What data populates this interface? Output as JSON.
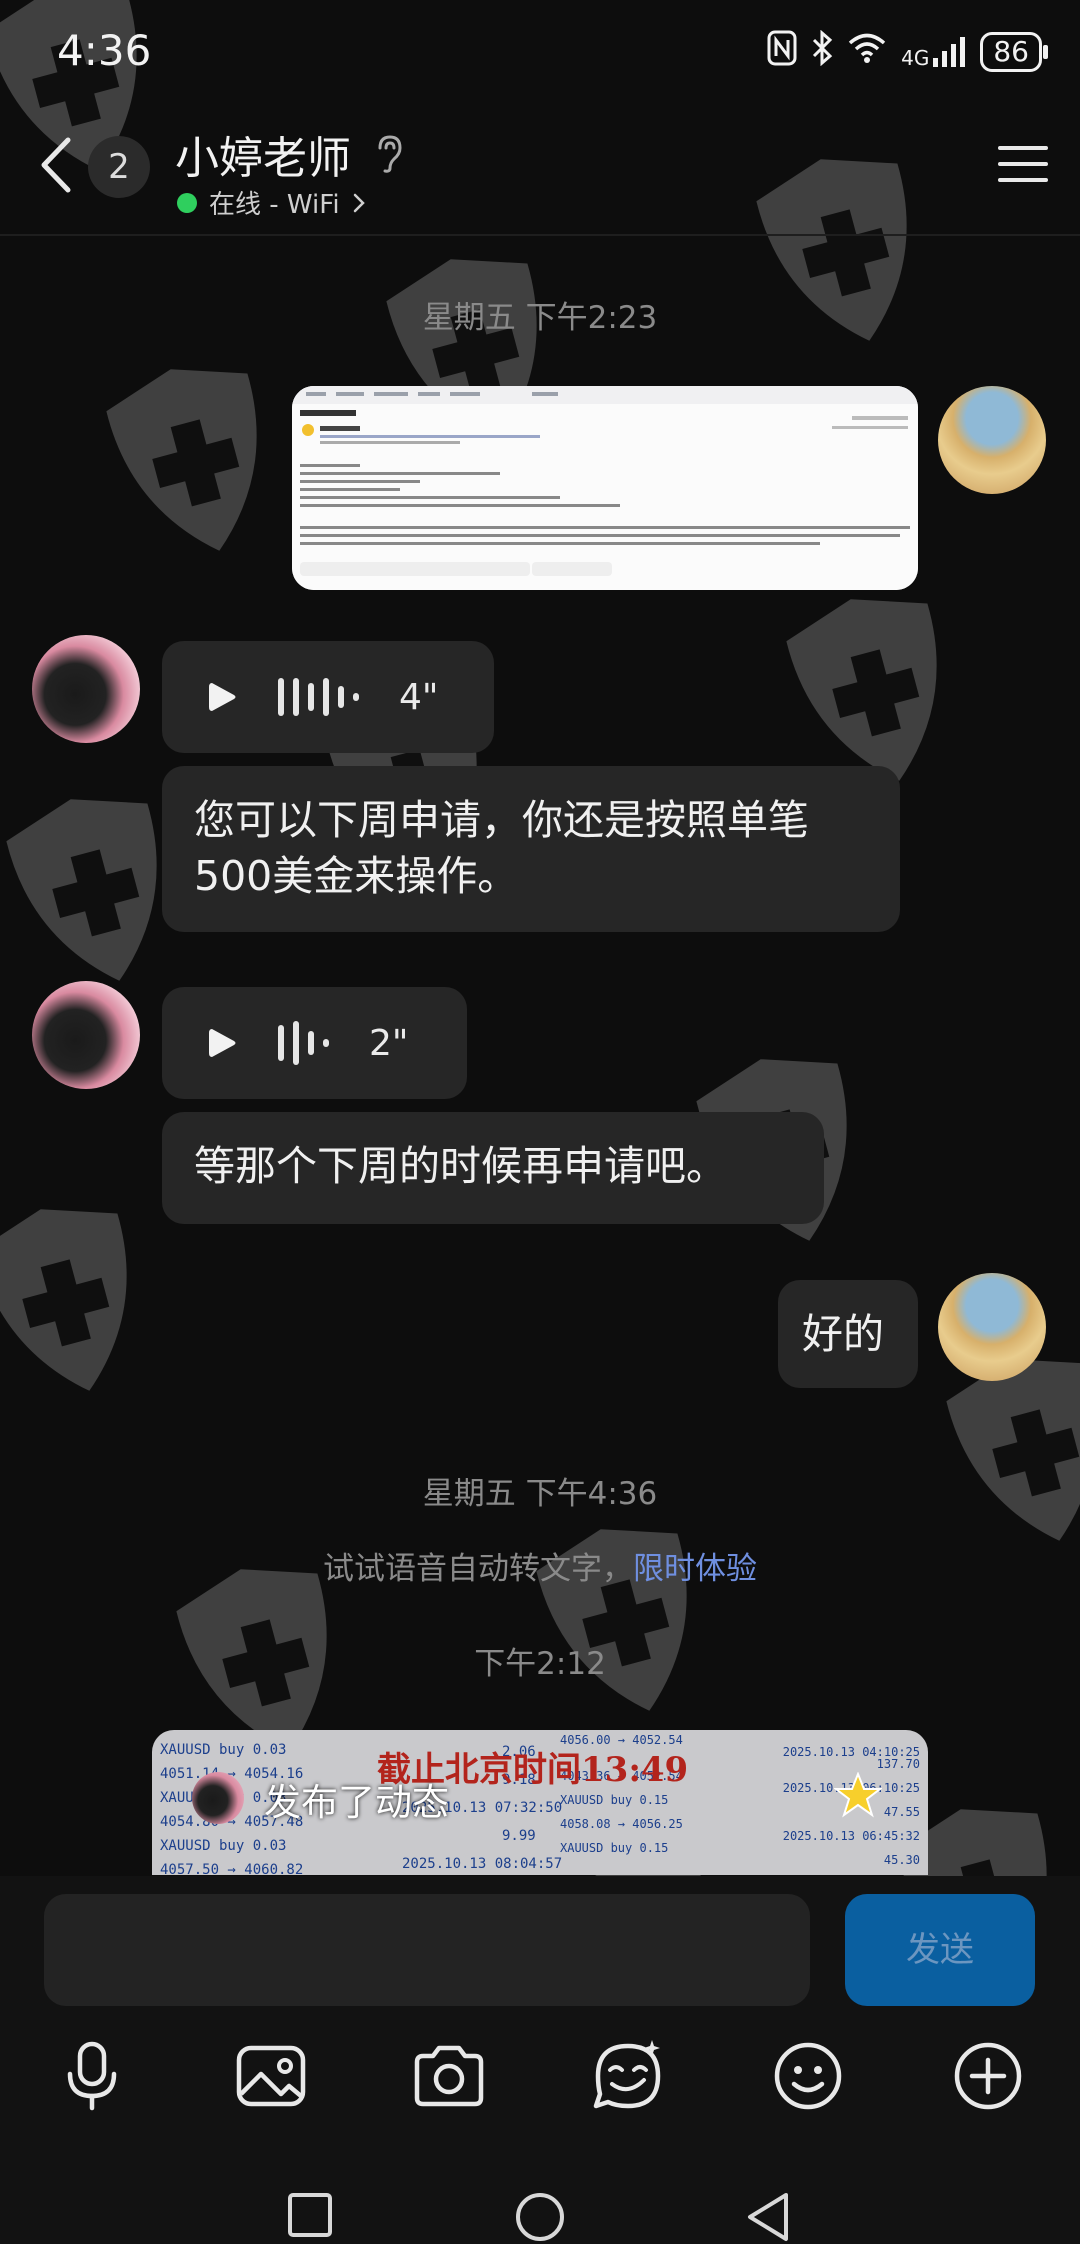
{
  "status_bar": {
    "time": "4:36",
    "network": "4G",
    "battery": "86"
  },
  "header": {
    "unread_count": "2",
    "contact_name": "小婷老师",
    "presence": "在线 - WiFi"
  },
  "messages": {
    "ts1": "星期五 下午2:23",
    "voice1_duration": "4\"",
    "text1": "您可以下周申请，你还是按照单笔500美金来操作。",
    "voice2_duration": "2\"",
    "text2": "等那个下周的时候再申请吧。",
    "reply_ok": "好的",
    "ts2": "星期五 下午4:36",
    "tip_text": "试试语音自动转文字，",
    "tip_link": "限时体验",
    "ts3": "下午2:12"
  },
  "feed_card": {
    "caption": "发布了动态",
    "headline": "截止北京时间13:49",
    "rows_left": [
      "XAUUSD buy 0.03",
      "4051.14 → 4054.16",
      "XAUUSD buy 0.03",
      "4054.80 → 4057.48",
      "XAUUSD buy 0.03",
      "4057.50 → 4060.82"
    ],
    "rows_mid": [
      "2.06",
      "9.18",
      "2025.10.13 07:32:50",
      "9.99",
      "2025.10.13 08:04:57"
    ],
    "rows_right": [
      "4056.00 → 4052.54",
      "2025.10.13 04:10:25",
      "137.70",
      "4043.36 → 4052.54",
      "2025.10.13 06:10:25",
      "XAUUSD buy 0.15",
      "47.55",
      "4058.08 → 4056.25",
      "2025.10.13 06:45:32",
      "XAUUSD buy 0.15",
      "45.30"
    ]
  },
  "composer": {
    "send_label": "发送"
  }
}
